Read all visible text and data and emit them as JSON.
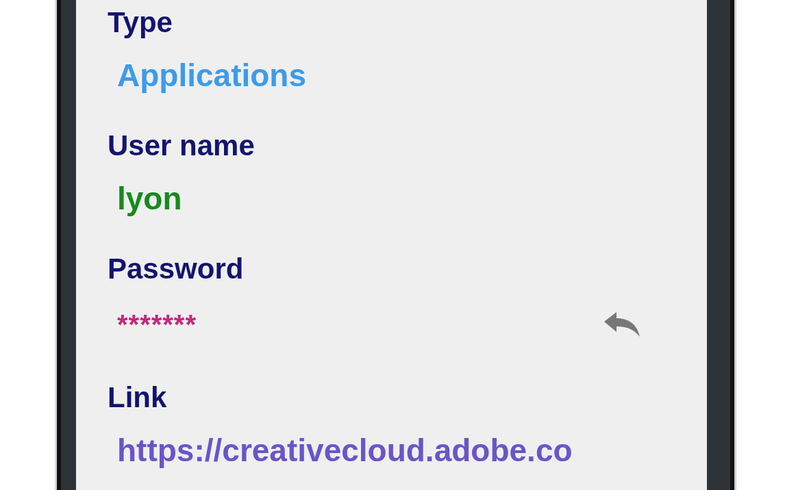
{
  "fields": [
    {
      "label": "Type",
      "value": "Applications",
      "color": "#3d9be9",
      "kind": "text"
    },
    {
      "label": "User name",
      "value": "lyon",
      "color": "#168a1e",
      "kind": "text"
    },
    {
      "label": "Password",
      "value": "*******",
      "color": "#c2287e",
      "kind": "secret"
    },
    {
      "label": "Link",
      "value": "https://creativecloud.adobe.co",
      "color": "#6a55c8",
      "kind": "text"
    }
  ]
}
